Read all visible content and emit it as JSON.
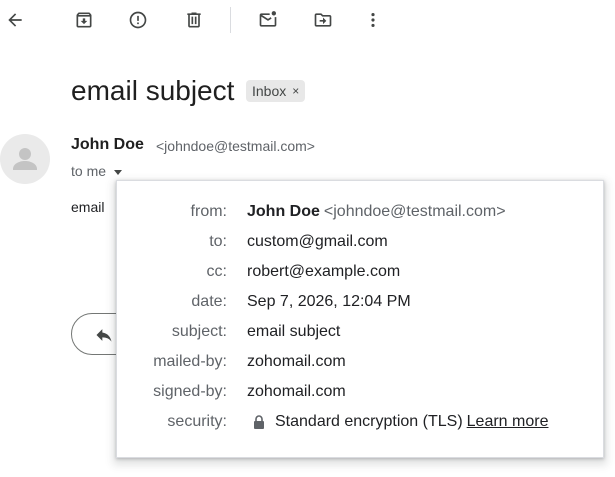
{
  "toolbar": {
    "items": [
      "back-arrow-icon",
      "archive-icon",
      "report-spam-icon",
      "delete-icon",
      "mark-unread-icon",
      "move-to-icon",
      "more-vert-icon"
    ]
  },
  "email": {
    "subject": "email subject",
    "label_chip": "Inbox",
    "label_chip_close": "×",
    "sender_name": "John Doe",
    "sender_email": "<johndoe@testmail.com>",
    "to_line": "to me",
    "body_preview": "email"
  },
  "details": {
    "from_label": "from:",
    "from_name": "John Doe",
    "from_email": "<johndoe@testmail.com>",
    "to_label": "to:",
    "to_value": "custom@gmail.com",
    "cc_label": "cc:",
    "cc_value": "robert@example.com",
    "date_label": "date:",
    "date_value": "Sep 7, 2026, 12:04 PM",
    "subject_label": "subject:",
    "subject_value": "email subject",
    "mailed_by_label": "mailed-by:",
    "mailed_by_value": "zohomail.com",
    "signed_by_label": "signed-by:",
    "signed_by_value": "zohomail.com",
    "security_label": "security:",
    "security_value": "Standard encryption (TLS)",
    "learn_more": "Learn more"
  },
  "colors": {
    "icon": "#444746",
    "label_text": "#5f6368",
    "chip_bg": "#e8e8e8",
    "avatar_bg": "#eaeaea"
  }
}
